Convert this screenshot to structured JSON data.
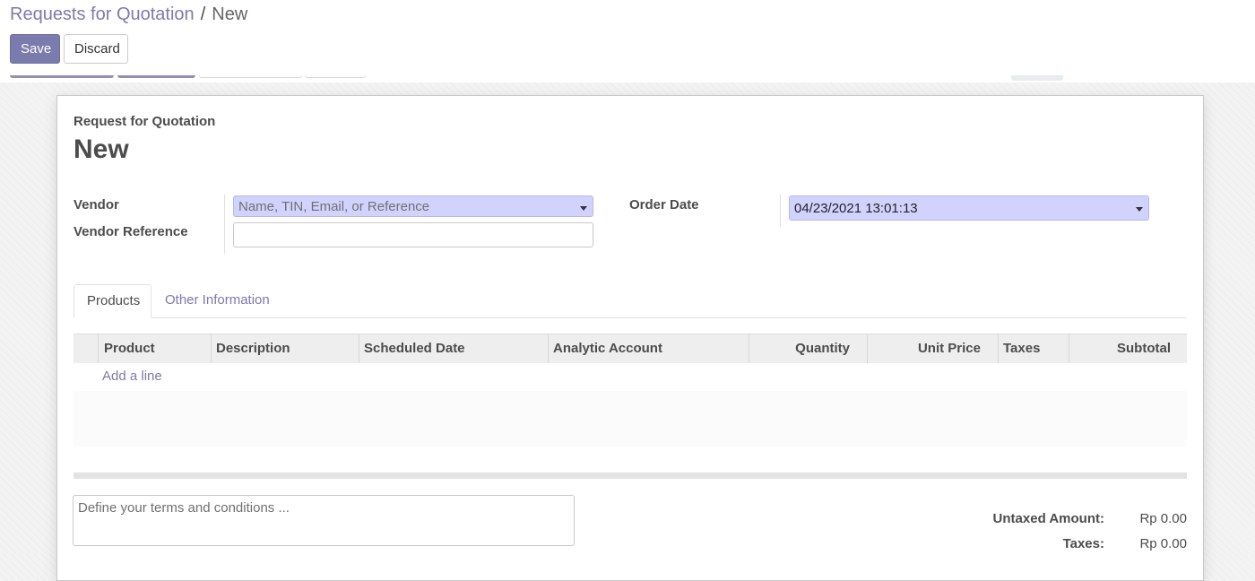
{
  "breadcrumb": {
    "parent": "Requests for Quotation",
    "separator": "/",
    "current": "New"
  },
  "toolbar": {
    "save_label": "Save",
    "discard_label": "Discard"
  },
  "colors": {
    "brand": "#7c7bad",
    "required_field_bg": "#d2d2ff"
  },
  "form": {
    "title_label": "Request for Quotation",
    "title": "New",
    "vendor": {
      "label": "Vendor",
      "placeholder": "Name, TIN, Email, or Reference"
    },
    "vendor_reference": {
      "label": "Vendor Reference",
      "value": ""
    },
    "order_date": {
      "label": "Order Date",
      "value": "04/23/2021 13:01:13"
    }
  },
  "tabs": [
    {
      "label": "Products",
      "active": true
    },
    {
      "label": "Other Information",
      "active": false
    }
  ],
  "order_lines": {
    "columns": [
      "Product",
      "Description",
      "Scheduled Date",
      "Analytic Account",
      "Quantity",
      "Unit Price",
      "Taxes",
      "Subtotal"
    ],
    "add_line_label": "Add a line"
  },
  "notes": {
    "placeholder": "Define your terms and conditions ..."
  },
  "totals": {
    "untaxed_label": "Untaxed Amount:",
    "untaxed_value": "Rp 0.00",
    "taxes_label": "Taxes:",
    "taxes_value": "Rp 0.00"
  }
}
